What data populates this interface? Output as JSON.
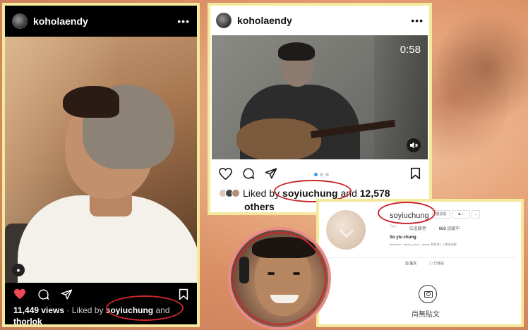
{
  "left_post": {
    "username": "koholaendy",
    "more": "•••",
    "views_count": "11,449 views",
    "liked_by_prefix": "· Liked by",
    "liked_by_user": "soyiuchung",
    "liked_by_suffix": "and",
    "liked_by_more": "thorlok"
  },
  "right_post": {
    "username": "koholaendy",
    "more": "•••",
    "video_time": "0:58",
    "liked_by_prefix": "Liked by",
    "liked_by_user": "soyiuchung",
    "liked_by_and": "and",
    "liked_by_count": "12,578",
    "liked_by_others": "others"
  },
  "profile": {
    "username": "soyiuchung",
    "btn_message": "發訊息",
    "btn_follow": "♟✓",
    "btn_more": "⌄",
    "stats": {
      "posts": "Ten",
      "followers": "位追蹤者",
      "following_count": "668",
      "following_label": "追蹤中"
    },
    "name": "So yiu chung",
    "followed_by": "finkmann · keung_show · jimyan 和其他 1 人都有追蹤",
    "tabs": [
      "▦ 貼文",
      "☐ 已標註"
    ],
    "empty_state": "尚無貼文"
  },
  "colors": {
    "frame": "#f5e99b",
    "highlight_ellipse": "#c8282d",
    "like_heart": "#ed4956",
    "dot_active": "#3897f0"
  },
  "icons": [
    "heart-icon",
    "comment-icon",
    "share-icon",
    "bookmark-icon",
    "mute-icon",
    "camera-icon",
    "tag-icon"
  ]
}
